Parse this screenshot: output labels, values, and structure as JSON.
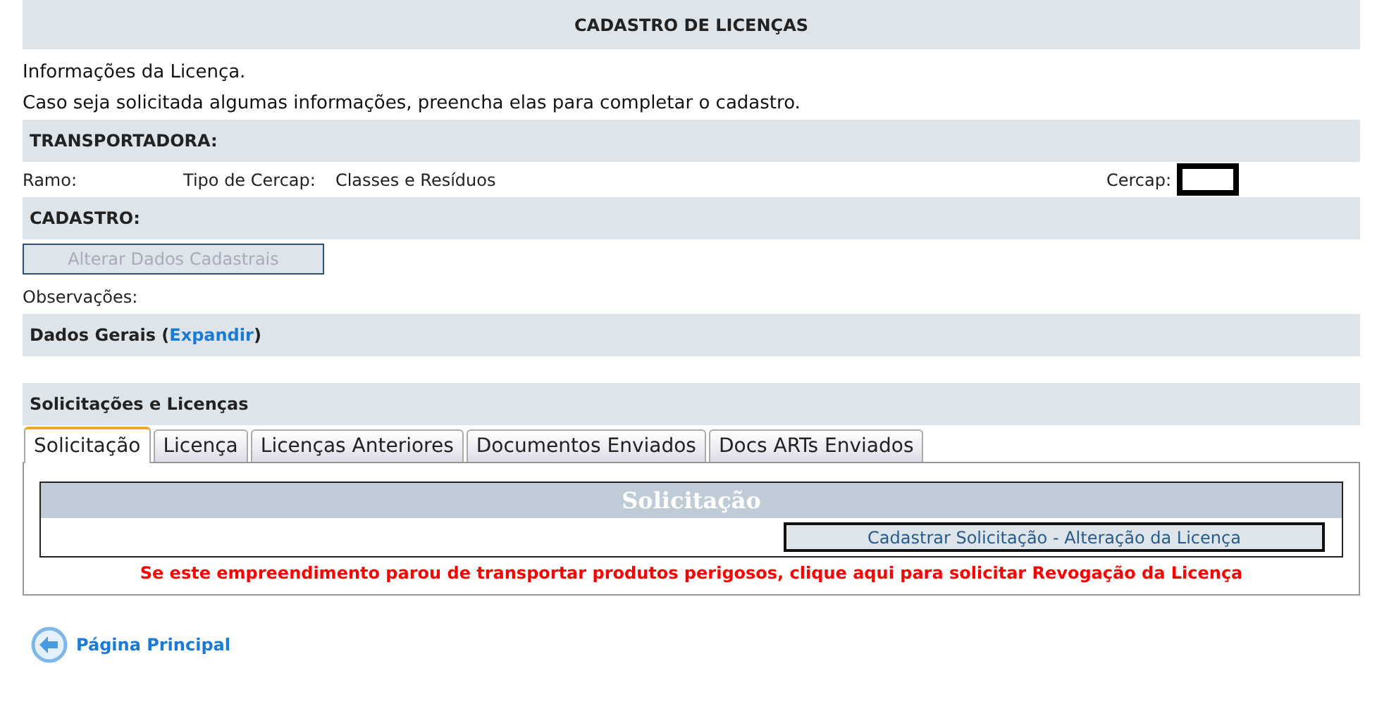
{
  "title": "CADASTRO DE LICENÇAS",
  "intro": [
    "Informações da Licença.",
    "Caso seja solicitada algumas informações, preencha elas para completar o cadastro."
  ],
  "transportadora": {
    "heading": "TRANSPORTADORA:",
    "ramo_label": "Ramo:",
    "tipo_label": "Tipo de Cercap:",
    "tipo_value": "Classes e Resíduos",
    "cercap_label": "Cercap:"
  },
  "cadastro": {
    "heading": "CADASTRO:",
    "button": {
      "label": "Alterar Dados Cadastrais",
      "disabled": true
    },
    "observacoes_label": "Observações:"
  },
  "dados_gerais": {
    "label": "Dados Gerais (",
    "link": "Expandir",
    "suffix": ")"
  },
  "solicitacoes": {
    "heading": "Solicitações e Licenças",
    "tabs": [
      {
        "label": "Solicitação",
        "selected": true
      },
      {
        "label": "Licença",
        "selected": false
      },
      {
        "label": "Licenças Anteriores",
        "selected": false
      },
      {
        "label": "Documentos Enviados",
        "selected": false
      },
      {
        "label": "Docs ARTs Enviados",
        "selected": false
      }
    ],
    "panel_title": "Solicitação",
    "action_button": "Cadastrar Solicitação - Alteração da Licença",
    "warning": "Se este empreendimento parou de transportar produtos perigosos, clique aqui para solicitar Revogação da Licença"
  },
  "home_link": "Página Principal"
}
